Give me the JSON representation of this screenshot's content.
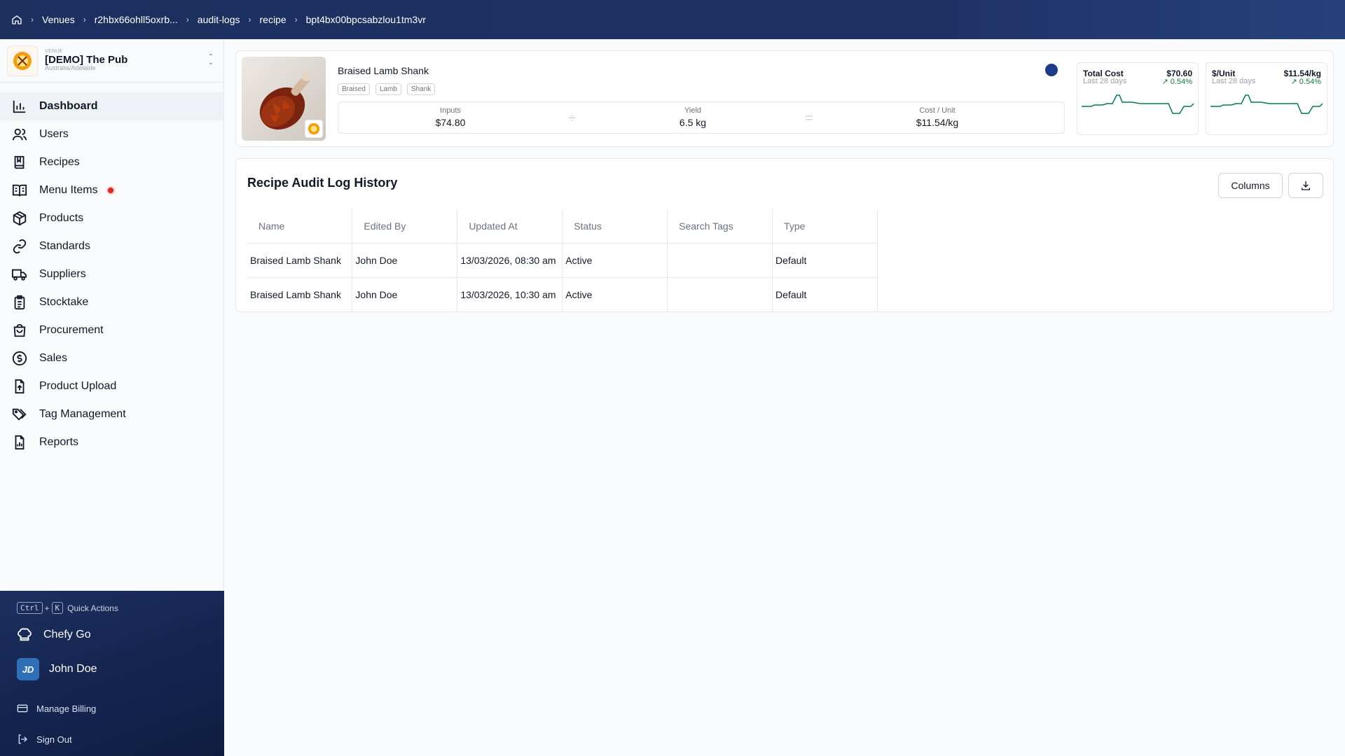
{
  "breadcrumb": {
    "items": [
      "Venues",
      "r2hbx66ohll5oxrb...",
      "audit-logs",
      "recipe",
      "bpt4bx00bpcsabzlou1tm3vr"
    ]
  },
  "venue": {
    "caption": "VENUE",
    "name": "[DEMO] The Pub",
    "timezone": "Australia/Adelaide"
  },
  "sidebar": {
    "items": [
      {
        "label": "Dashboard",
        "icon": "bar-chart-icon",
        "active": true
      },
      {
        "label": "Users",
        "icon": "users-icon"
      },
      {
        "label": "Recipes",
        "icon": "book-icon"
      },
      {
        "label": "Menu Items",
        "icon": "open-book-icon",
        "badge": true
      },
      {
        "label": "Products",
        "icon": "box-icon"
      },
      {
        "label": "Standards",
        "icon": "link-icon"
      },
      {
        "label": "Suppliers",
        "icon": "truck-icon"
      },
      {
        "label": "Stocktake",
        "icon": "clipboard-icon"
      },
      {
        "label": "Procurement",
        "icon": "shopping-bag-icon"
      },
      {
        "label": "Sales",
        "icon": "dollar-circle-icon"
      },
      {
        "label": "Product Upload",
        "icon": "file-upload-icon"
      },
      {
        "label": "Tag Management",
        "icon": "tags-icon"
      },
      {
        "label": "Reports",
        "icon": "file-chart-icon"
      }
    ],
    "quick_actions": {
      "key1": "Ctrl",
      "plus": "+",
      "key2": "K",
      "label": "Quick Actions"
    },
    "chefy_go": "Chefy Go",
    "user": {
      "initials": "JD",
      "name": "John Doe"
    },
    "manage_billing": "Manage Billing",
    "sign_out": "Sign Out"
  },
  "recipe": {
    "title": "Braised Lamb Shank",
    "tags": [
      "Braised",
      "Lamb",
      "Shank"
    ],
    "inputs_label": "Inputs",
    "inputs_value": "$74.80",
    "yield_label": "Yield",
    "yield_value": "6.5 kg",
    "cost_unit_label": "Cost / Unit",
    "cost_unit_value": "$11.54/kg",
    "status_color": "#1e3a8a"
  },
  "metrics": [
    {
      "title": "Total Cost",
      "subtitle": "Last 28 days",
      "value": "$70.60",
      "change": "0.54%"
    },
    {
      "title": "$/Unit",
      "subtitle": "Last 28 days",
      "value": "$11.54/kg",
      "change": "0.54%"
    }
  ],
  "audit": {
    "title": "Recipe Audit Log History",
    "columns_button": "Columns",
    "headers": [
      "Name",
      "Edited By",
      "Updated At",
      "Status",
      "Search Tags",
      "Type"
    ],
    "rows": [
      [
        "Braised Lamb Shank",
        "John Doe",
        "13/03/2026, 08:30 am",
        "Active",
        "",
        "Default"
      ],
      [
        "Braised Lamb Shank",
        "John Doe",
        "13/03/2026, 10:30 am",
        "Active",
        "",
        "Default"
      ]
    ]
  },
  "colors": {
    "header_bg": "#1c2f5f",
    "accent": "#1e3a8a",
    "positive": "#15803d",
    "badge": "#dc2626"
  }
}
